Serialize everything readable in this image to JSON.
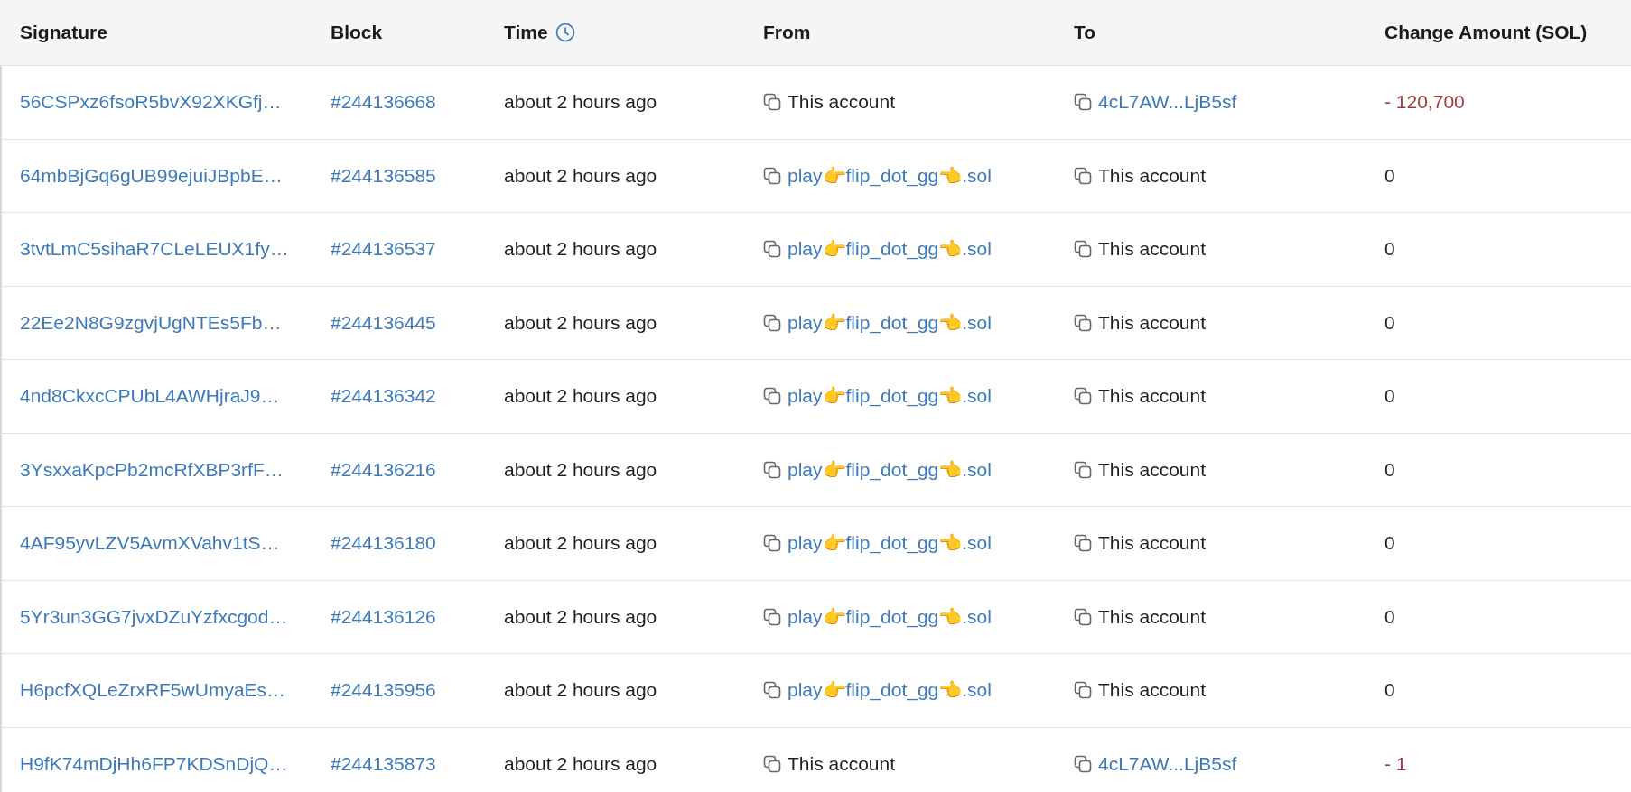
{
  "table": {
    "columns": [
      {
        "label": "Signature",
        "kind": "plain"
      },
      {
        "label": "Block",
        "kind": "plain"
      },
      {
        "label": "Time",
        "kind": "timed"
      },
      {
        "label": "From",
        "kind": "plain"
      },
      {
        "label": "To",
        "kind": "plain"
      },
      {
        "label": "Change Amount (SOL)",
        "kind": "plain"
      }
    ],
    "rows": [
      {
        "signature": "56CSPxz6fsoR5bvX92XKGfj…",
        "block": "#244136668",
        "time": "about 2 hours ago",
        "from": {
          "text": "This account",
          "kind": "plain"
        },
        "to": {
          "text": "4cL7AW...LjB5sf",
          "kind": "link"
        },
        "amount": {
          "text": "- 120,700",
          "kind": "debit"
        }
      },
      {
        "signature": "64mbBjGq6gUB99ejuiJBpbE…",
        "block": "#244136585",
        "time": "about 2 hours ago",
        "from": {
          "text": "play👉flip_dot_gg👈.sol",
          "kind": "link"
        },
        "to": {
          "text": "This account",
          "kind": "plain"
        },
        "amount": {
          "text": "0",
          "kind": "zero"
        }
      },
      {
        "signature": "3tvtLmC5sihaR7CLeLEUX1fy…",
        "block": "#244136537",
        "time": "about 2 hours ago",
        "from": {
          "text": "play👉flip_dot_gg👈.sol",
          "kind": "link"
        },
        "to": {
          "text": "This account",
          "kind": "plain"
        },
        "amount": {
          "text": "0",
          "kind": "zero"
        }
      },
      {
        "signature": "22Ee2N8G9zgvjUgNTEs5Fb…",
        "block": "#244136445",
        "time": "about 2 hours ago",
        "from": {
          "text": "play👉flip_dot_gg👈.sol",
          "kind": "link"
        },
        "to": {
          "text": "This account",
          "kind": "plain"
        },
        "amount": {
          "text": "0",
          "kind": "zero"
        }
      },
      {
        "signature": "4nd8CkxcCPUbL4AWHjraJ9…",
        "block": "#244136342",
        "time": "about 2 hours ago",
        "from": {
          "text": "play👉flip_dot_gg👈.sol",
          "kind": "link"
        },
        "to": {
          "text": "This account",
          "kind": "plain"
        },
        "amount": {
          "text": "0",
          "kind": "zero"
        }
      },
      {
        "signature": "3YsxxaKpcPb2mcRfXBP3rfF…",
        "block": "#244136216",
        "time": "about 2 hours ago",
        "from": {
          "text": "play👉flip_dot_gg👈.sol",
          "kind": "link"
        },
        "to": {
          "text": "This account",
          "kind": "plain"
        },
        "amount": {
          "text": "0",
          "kind": "zero"
        }
      },
      {
        "signature": "4AF95yvLZV5AvmXVahv1tS…",
        "block": "#244136180",
        "time": "about 2 hours ago",
        "from": {
          "text": "play👉flip_dot_gg👈.sol",
          "kind": "link"
        },
        "to": {
          "text": "This account",
          "kind": "plain"
        },
        "amount": {
          "text": "0",
          "kind": "zero"
        }
      },
      {
        "signature": "5Yr3un3GG7jvxDZuYzfxcgod…",
        "block": "#244136126",
        "time": "about 2 hours ago",
        "from": {
          "text": "play👉flip_dot_gg👈.sol",
          "kind": "link"
        },
        "to": {
          "text": "This account",
          "kind": "plain"
        },
        "amount": {
          "text": "0",
          "kind": "zero"
        }
      },
      {
        "signature": "H6pcfXQLeZrxRF5wUmyaEs…",
        "block": "#244135956",
        "time": "about 2 hours ago",
        "from": {
          "text": "play👉flip_dot_gg👈.sol",
          "kind": "link"
        },
        "to": {
          "text": "This account",
          "kind": "plain"
        },
        "amount": {
          "text": "0",
          "kind": "zero"
        }
      },
      {
        "signature": "H9fK74mDjHh6FP7KDSnDjQ…",
        "block": "#244135873",
        "time": "about 2 hours ago",
        "from": {
          "text": "This account",
          "kind": "plain"
        },
        "to": {
          "text": "4cL7AW...LjB5sf",
          "kind": "link"
        },
        "amount": {
          "text": "- 1",
          "kind": "debit"
        }
      }
    ]
  }
}
